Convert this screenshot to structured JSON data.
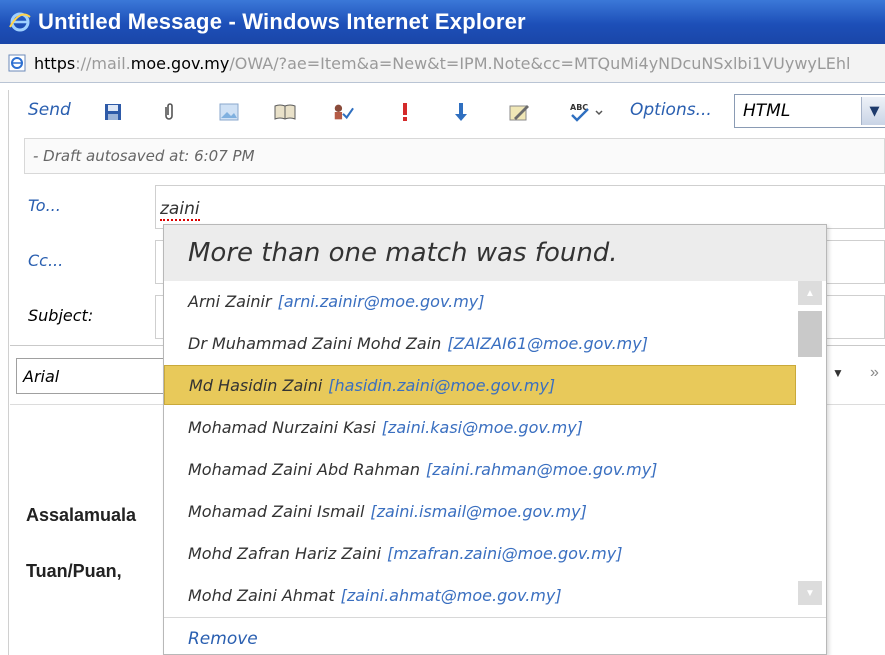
{
  "window": {
    "title": "Untitled Message - Windows Internet Explorer"
  },
  "address": {
    "scheme": "https",
    "sep": "://",
    "subdomain": "mail.",
    "host": "moe.gov.my",
    "path": "/OWA/?ae=Item&a=New&t=IPM.Note&cc=MTQuMi4yNDcuNSxlbi1VUywyLEhl"
  },
  "toolbar": {
    "send_label": "Send",
    "options_label": "Options...",
    "format_value": "HTML",
    "icons": [
      "save-icon",
      "attach-icon",
      "image-icon",
      "address-book-icon",
      "check-names-icon",
      "high-importance-icon",
      "low-importance-icon",
      "signature-icon",
      "spell-check-icon"
    ]
  },
  "draft": {
    "notice": "- Draft autosaved at: 6:07 PM"
  },
  "fields": {
    "to_label": "To...",
    "to_value": "zaini",
    "cc_label": "Cc...",
    "subject_label": "Subject:"
  },
  "format": {
    "font_value": "Arial"
  },
  "body": {
    "line1": "Assalamuala",
    "line2": "Tuan/Puan,"
  },
  "popup": {
    "header": "More than one match was found.",
    "matches": [
      {
        "name": "Arni Zainir",
        "email": "[arni.zainir@moe.gov.my]"
      },
      {
        "name": "Dr Muhammad Zaini Mohd Zain",
        "email": "[ZAIZAI61@moe.gov.my]"
      },
      {
        "name": "Md Hasidin Zaini",
        "email": "[hasidin.zaini@moe.gov.my]"
      },
      {
        "name": "Mohamad Nurzaini Kasi",
        "email": "[zaini.kasi@moe.gov.my]"
      },
      {
        "name": "Mohamad Zaini Abd Rahman",
        "email": "[zaini.rahman@moe.gov.my]"
      },
      {
        "name": "Mohamad Zaini Ismail",
        "email": "[zaini.ismail@moe.gov.my]"
      },
      {
        "name": "Mohd Zafran Hariz Zaini",
        "email": "[mzafran.zaini@moe.gov.my]"
      },
      {
        "name": "Mohd Zaini Ahmat",
        "email": "[zaini.ahmat@moe.gov.my]"
      }
    ],
    "selected_index": 2,
    "remove_label": "Remove"
  },
  "colors": {
    "titlebar": "#1d4fb8",
    "link": "#2a5fb0",
    "selected": "#e8c95a"
  }
}
